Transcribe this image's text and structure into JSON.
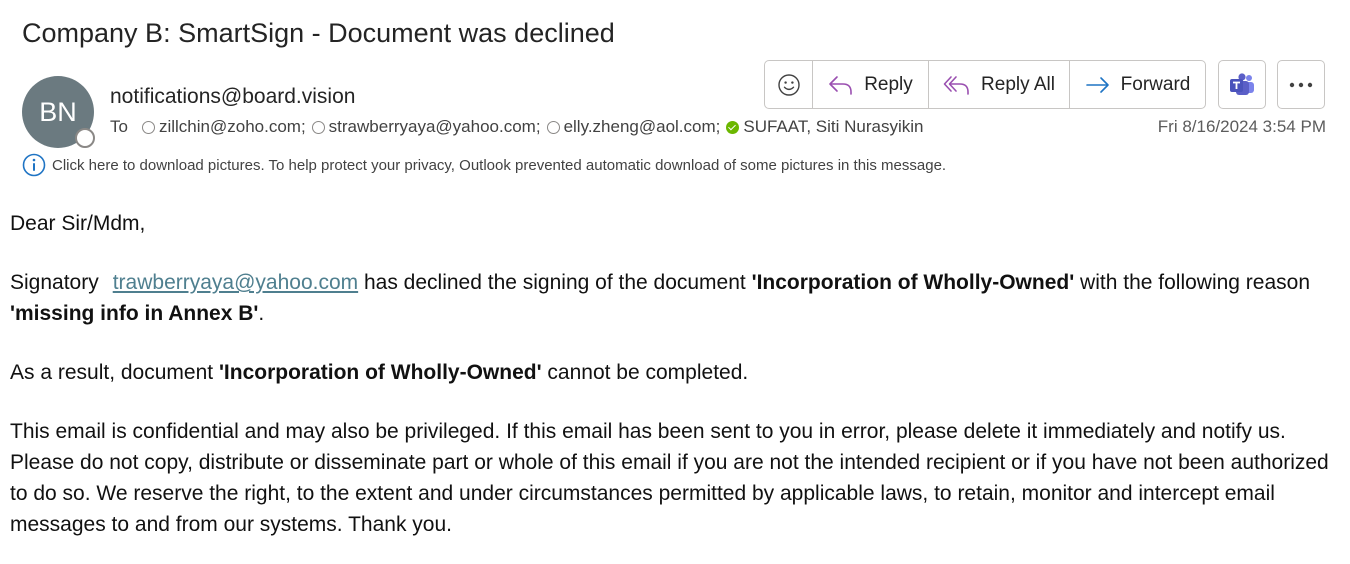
{
  "subject": "Company B: SmartSign - Document was declined",
  "sender": {
    "initials": "BN",
    "email": "notifications@board.vision"
  },
  "to": {
    "label": "To",
    "recipients": [
      {
        "name": "zillchin@zoho.com;",
        "status": "offline"
      },
      {
        "name": "strawberryaya@yahoo.com;",
        "status": "offline"
      },
      {
        "name": "elly.zheng@aol.com;",
        "status": "offline"
      },
      {
        "name": "SUFAAT, Siti Nurasyikin",
        "status": "available"
      }
    ]
  },
  "date": "Fri 8/16/2024 3:54 PM",
  "toolbar": {
    "reply": "Reply",
    "reply_all": "Reply All",
    "forward": "Forward"
  },
  "info_bar": "Click here to download pictures. To help protect your privacy, Outlook prevented automatic download of some pictures in this message.",
  "body": {
    "greeting": "Dear Sir/Mdm,",
    "p1_a": "Signatory",
    "p1_link": "trawberryaya@yahoo.com",
    "p1_b": " has declined the signing of the document ",
    "p1_doc": "'Incorporation of Wholly-Owned'",
    "p1_c": " with the following reason ",
    "p1_reason": "'missing info in Annex B'",
    "p1_d": ".",
    "p2_a": "As a result, document ",
    "p2_doc": "'Incorporation of Wholly-Owned'",
    "p2_b": " cannot be completed.",
    "p3": "This email is confidential and may also be privileged. If this email has been sent to you in error, please delete it immediately and notify us. Please do not copy, distribute or disseminate part or whole of this email if you are not the intended recipient or if you have not been authorized to do so. We reserve the right, to the extent and under circumstances permitted by applicable laws, to retain, monitor and intercept email messages to and from our systems. Thank you."
  },
  "colors": {
    "avatar_bg": "#6b7a80",
    "reply_arrow": "#9a4fb0",
    "forward_arrow": "#1f74c4",
    "teams": "#5b5fc7",
    "link": "#4f7f8f",
    "available": "#6bb700"
  }
}
